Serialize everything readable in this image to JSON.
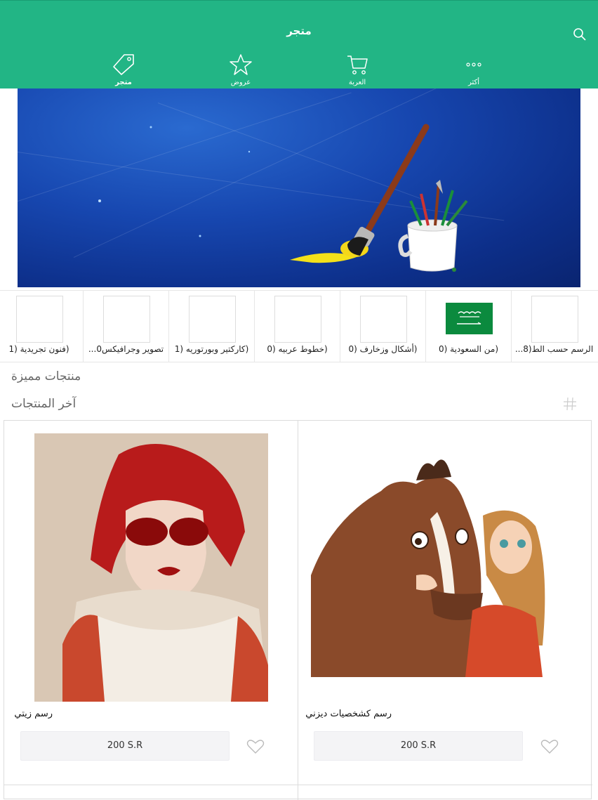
{
  "header": {
    "title": "متجر",
    "nav": [
      {
        "label": "متجر",
        "icon": "tag-icon"
      },
      {
        "label": "عروض",
        "icon": "star-icon"
      },
      {
        "label": "العربة",
        "icon": "cart-icon"
      },
      {
        "label": "أكثر",
        "icon": "more-icon"
      }
    ]
  },
  "categories": [
    {
      "label": "(فنون تجريدية (1"
    },
    {
      "label": "تصوير وجرافيكس0..."
    },
    {
      "label": "(كاركتير وبورتوريه (1"
    },
    {
      "label": "(خطوط عربيه (0"
    },
    {
      "label": "(أشكال وزخارف (0"
    },
    {
      "label": "(من السعودية (0"
    },
    {
      "label": "الرسم حسب الط(8..."
    }
  ],
  "sections": {
    "featured": "منتجات مميزة",
    "latest": "آخر المنتجات"
  },
  "products": [
    {
      "name": "رسم زيتي",
      "price": "200 S.R"
    },
    {
      "name": "رسم كشخصيات ديزني",
      "price": "200 S.R"
    }
  ],
  "colors": {
    "brand": "#22b585",
    "banner": "#1747b0"
  }
}
